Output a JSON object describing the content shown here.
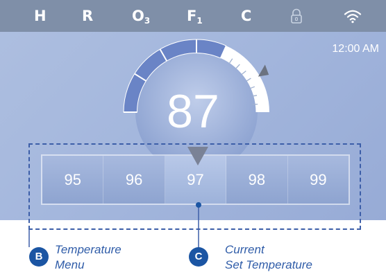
{
  "status_bar": {
    "items": [
      {
        "label": "H"
      },
      {
        "label": "R"
      },
      {
        "label": "O",
        "sub": "3"
      },
      {
        "label": "F",
        "sub": "1"
      },
      {
        "label": "C"
      }
    ],
    "icons": [
      "lock-icon",
      "wifi-icon"
    ]
  },
  "clock": "12:00 AM",
  "current_temperature": "87",
  "temperature_menu": {
    "options": [
      "95",
      "96",
      "97",
      "98",
      "99"
    ],
    "selected": "97"
  },
  "callouts": [
    {
      "badge": "B",
      "line1": "Temperature",
      "line2": "Menu"
    },
    {
      "badge": "C",
      "line1": "Current",
      "line2": "Set Temperature"
    }
  ],
  "colors": {
    "panel": "#a4b7dd",
    "status_bar": "#7f8fa8",
    "callout_blue": "#1b55a3",
    "frame_dashes": "#3c5ea8"
  }
}
